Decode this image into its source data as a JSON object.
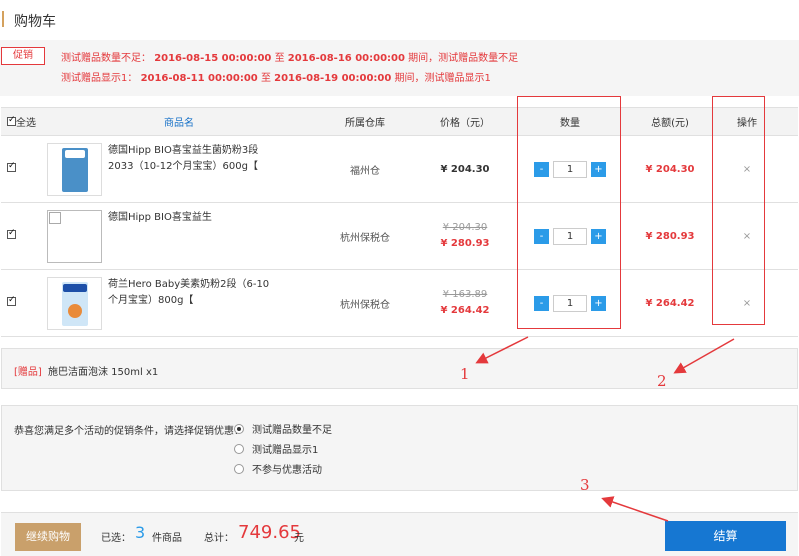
{
  "header": {
    "title": "购物车"
  },
  "promo": {
    "tag": "促销",
    "line1": {
      "prefix": "测试赠品数量不足：",
      "start": "2016-08-15 00:00:00",
      "to": "至",
      "end": "2016-08-16 00:00:00",
      "suffix": "期间，测试赠品数量不足"
    },
    "line2": {
      "prefix": "测试赠品显示1：",
      "start": "2016-08-11 00:00:00",
      "to": "至",
      "end": "2016-08-19 00:00:00",
      "suffix": "期间，测试赠品显示1"
    }
  },
  "table": {
    "headers": {
      "select_all": "全选",
      "name": "商品名",
      "warehouse": "所属仓库",
      "price": "价格（元）",
      "qty": "数量",
      "total": "总额(元)",
      "action": "操作"
    },
    "rows": [
      {
        "checked": true,
        "name": "德国Hipp BIO喜宝益生菌奶粉3段 2033（10-12个月宝宝）600g【",
        "warehouse": "福州仓",
        "price_old": "",
        "price": "¥ 204.30",
        "qty": "1",
        "total": "¥ 204.30",
        "thumb_color": "#4a90c8"
      },
      {
        "checked": true,
        "name": "德国Hipp BIO喜宝益生",
        "warehouse": "杭州保税仓",
        "price_old": "¥ 204.30",
        "price": "¥ 280.93",
        "qty": "1",
        "total": "¥ 280.93",
        "thumb_color": ""
      },
      {
        "checked": true,
        "name": "荷兰Hero Baby美素奶粉2段（6-10个月宝宝）800g【",
        "warehouse": "杭州保税仓",
        "price_old": "¥ 163.89",
        "price": "¥ 264.42",
        "qty": "1",
        "total": "¥ 264.42",
        "thumb_color": "#7ab8e8"
      }
    ],
    "qty_minus": "-",
    "qty_plus": "+",
    "delete_symbol": "×"
  },
  "gift": {
    "tag": "[赠品]",
    "text": "施巴洁面泡沫 150ml x1"
  },
  "promo_options": {
    "prompt": "恭喜您满足多个活动的促销条件，请选择促销优惠：",
    "options": [
      {
        "label": "测试赠品数量不足",
        "selected": true
      },
      {
        "label": "测试赠品显示1",
        "selected": false
      },
      {
        "label": "不参与优惠活动",
        "selected": false
      }
    ]
  },
  "footer": {
    "continue": "继续购物",
    "selected_label": "已选：",
    "selected_count": "3",
    "selected_unit": "件商品",
    "total_label": "总计：",
    "total": "749.65",
    "currency": "元",
    "checkout": "结算"
  },
  "annotations": {
    "one": "1",
    "two": "2",
    "three": "3"
  },
  "colors": {
    "accent_red": "#e4393c",
    "accent_blue": "#2b9be8",
    "checkout_blue": "#1677d2",
    "brand_gold": "#c9a06b"
  }
}
